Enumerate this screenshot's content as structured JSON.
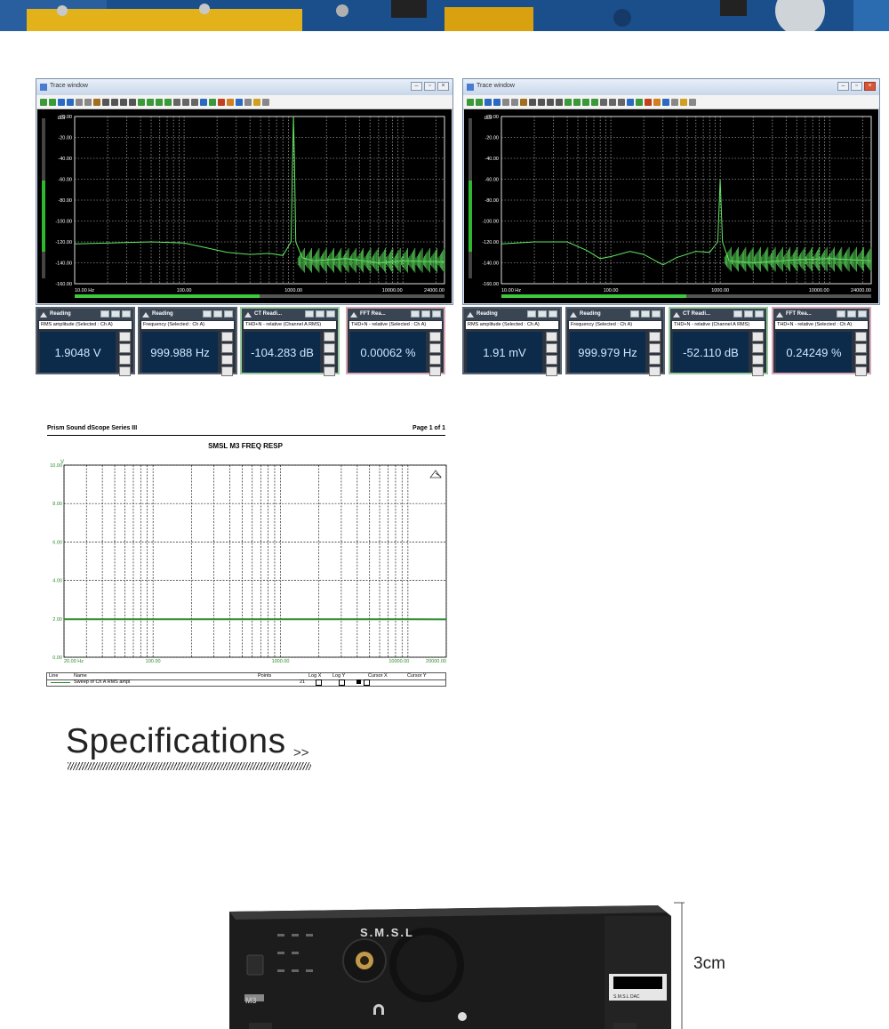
{
  "trace_windows": [
    {
      "title": "Trace window",
      "y_unit": "dBr",
      "y_ticks": [
        "0.00",
        "-20.00",
        "-40.00",
        "-60.00",
        "-80.00",
        "-100.00",
        "-120.00",
        "-140.00",
        "-160.00"
      ],
      "x_ticks": [
        "10.00 Hz",
        "100.00",
        "1000.00",
        "10000.00",
        "24000.00"
      ],
      "readings": [
        {
          "title": "Reading",
          "subtitle": "RMS amplitude (Selected : Ch A)",
          "value": "1.9048 V"
        },
        {
          "title": "Reading",
          "subtitle": "Frequency (Selected : Ch A)",
          "value": "999.988 Hz"
        },
        {
          "title": "CT Readi...",
          "subtitle": "THD+N - relative (Channel A RMS)",
          "value": "-104.283 dB"
        },
        {
          "title": "FFT Rea...",
          "subtitle": "THD+N - relative (Selected : Ch A)",
          "value": "0.00062 %"
        }
      ]
    },
    {
      "title": "Trace window",
      "y_unit": "dBr",
      "y_ticks": [
        "0.00",
        "-20.00",
        "-40.00",
        "-60.00",
        "-80.00",
        "-100.00",
        "-120.00",
        "-140.00",
        "-160.00"
      ],
      "x_ticks": [
        "10.00 Hz",
        "100.00",
        "1000.00",
        "10000.00",
        "24000.00"
      ],
      "readings": [
        {
          "title": "Reading",
          "subtitle": "RMS amplitude (Selected : Ch A)",
          "value": "1.91 mV"
        },
        {
          "title": "Reading",
          "subtitle": "Frequency (Selected : Ch A)",
          "value": "999.979 Hz"
        },
        {
          "title": "CT Readi...",
          "subtitle": "THD+N - relative (Channel A RMS)",
          "value": "-52.110 dB"
        },
        {
          "title": "FFT Rea...",
          "subtitle": "THD+N - relative (Selected : Ch A)",
          "value": "0.24249 %"
        }
      ]
    }
  ],
  "freq_resp_doc": {
    "header_left": "Prism Sound dScope Series III",
    "header_right": "Page 1 of 1",
    "title": "SMSL M3  FREQ RESP",
    "y_unit": "V",
    "y_ticks": [
      "10.00",
      "8.00",
      "6.00",
      "4.00",
      "2.00",
      "0.00"
    ],
    "x_ticks": [
      "20.00 Hz",
      "100.00",
      "1000.00",
      "10000.00",
      "20000.00"
    ],
    "legend_headers": [
      "Line",
      "Name",
      "Points",
      "Log X",
      "Log Y",
      "Cursor X",
      "Cursor Y"
    ],
    "legend_row": {
      "name": "Sweep of Ch A RMS ampl",
      "points": "21"
    }
  },
  "chart_data": [
    {
      "type": "line",
      "x_scale": "log",
      "x_range_hz": [
        10,
        24000
      ],
      "ylim": [
        -160,
        0
      ],
      "ylabel": "dBr",
      "x_tick_labels": [
        "10.00 Hz",
        "100.00",
        "1000.00",
        "10000.00",
        "24000.00"
      ],
      "series": [
        {
          "x": [
            10,
            50,
            100,
            150,
            250,
            400,
            600,
            800,
            950,
            980,
            1000,
            1020,
            1050,
            1200,
            1500,
            3000,
            6000,
            10000,
            24000
          ],
          "y": [
            -122,
            -120,
            -121,
            -125,
            -130,
            -132,
            -131,
            -133,
            -120,
            -40,
            0,
            -40,
            -120,
            -135,
            -138,
            -136,
            -140,
            -138,
            -139
          ]
        }
      ],
      "color": "#5fe65f"
    },
    {
      "type": "line",
      "x_scale": "log",
      "x_range_hz": [
        10,
        24000
      ],
      "ylim": [
        -160,
        0
      ],
      "ylabel": "dBr",
      "x_tick_labels": [
        "10.00 Hz",
        "100.00",
        "1000.00",
        "10000.00",
        "24000.00"
      ],
      "series": [
        {
          "x": [
            10,
            20,
            40,
            60,
            80,
            100,
            150,
            200,
            300,
            400,
            600,
            800,
            950,
            1000,
            1050,
            1200,
            2000,
            5000,
            10000,
            24000
          ],
          "y": [
            -122,
            -120,
            -120,
            -128,
            -136,
            -134,
            -129,
            -132,
            -142,
            -135,
            -129,
            -130,
            -120,
            -60,
            -120,
            -138,
            -140,
            -137,
            -136,
            -138
          ]
        }
      ],
      "color": "#5fe65f"
    },
    {
      "type": "line",
      "x_scale": "log",
      "title": "SMSL M3  FREQ RESP",
      "ylabel": "V",
      "ylim": [
        0,
        10
      ],
      "x_range_hz": [
        20,
        20000
      ],
      "x_tick_labels": [
        "20.00 Hz",
        "100.00",
        "1000.00",
        "10000.00",
        "20000.00"
      ],
      "series": [
        {
          "name": "Sweep of Ch A RMS ampl",
          "x": [
            20,
            50,
            100,
            500,
            1000,
            5000,
            10000,
            20000
          ],
          "y": [
            1.98,
            1.98,
            1.98,
            1.98,
            1.98,
            1.98,
            1.98,
            1.97
          ]
        }
      ],
      "color": "#2e8b2e"
    }
  ],
  "specs": {
    "heading": "Specifications",
    "chevrons": ">>"
  },
  "product": {
    "brand": "S.M.S.L",
    "model": "M3",
    "sticker": "S.M.S.L DAC",
    "dimension": "3cm"
  },
  "colors": {
    "trace_green": "#5fe65f",
    "plot_bg": "#000000",
    "grid": "#e0e0e0",
    "reading_bg": "#0c2a4a"
  }
}
